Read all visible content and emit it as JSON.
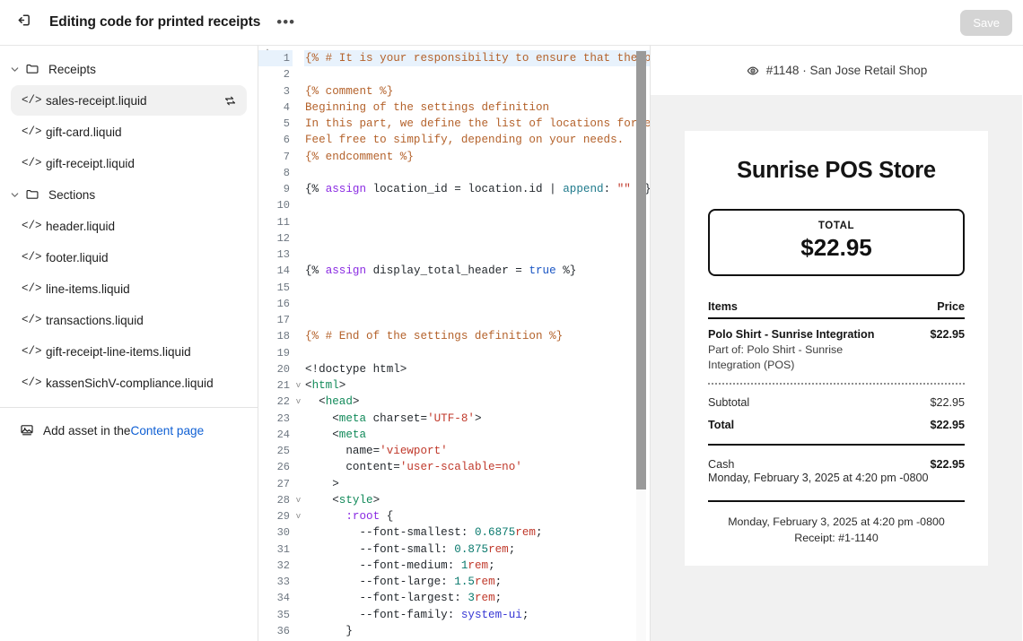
{
  "topbar": {
    "back_icon": "exit-arrow-icon",
    "title": "Editing code for printed receipts",
    "more_label": "•••",
    "save_label": "Save",
    "save_disabled": true,
    "save_bg": "#d4d4d4"
  },
  "sidebar": {
    "groups": [
      {
        "label": "Receipts",
        "icon": "folder-icon",
        "expanded": true,
        "files": [
          {
            "label": "sales-receipt.liquid",
            "selected": true,
            "trailing_icon": "sync-arrows-icon"
          },
          {
            "label": "gift-card.liquid",
            "selected": false,
            "trailing_icon": ""
          },
          {
            "label": "gift-receipt.liquid",
            "selected": false,
            "trailing_icon": ""
          }
        ]
      },
      {
        "label": "Sections",
        "icon": "folder-icon",
        "expanded": true,
        "files": [
          {
            "label": "header.liquid",
            "selected": false,
            "trailing_icon": ""
          },
          {
            "label": "footer.liquid",
            "selected": false,
            "trailing_icon": ""
          },
          {
            "label": "line-items.liquid",
            "selected": false,
            "trailing_icon": ""
          },
          {
            "label": "transactions.liquid",
            "selected": false,
            "trailing_icon": ""
          },
          {
            "label": "gift-receipt-line-items.liquid",
            "selected": false,
            "trailing_icon": ""
          },
          {
            "label": "kassenSichV-compliance.liquid",
            "selected": false,
            "trailing_icon": ""
          }
        ]
      }
    ],
    "add_asset": {
      "icon": "image-icon",
      "text_before": "Add asset in the ",
      "link_text": "Content page",
      "link_color": "#1060d4"
    }
  },
  "editor": {
    "active_line": 1,
    "first_line_number": 1,
    "last_line_number": 36,
    "lines": [
      {
        "n": 1,
        "fold": "",
        "tokens": [
          {
            "t": "{% # It is your responsibility to ensure that the prin",
            "c": "t-com"
          }
        ]
      },
      {
        "n": 2,
        "fold": "",
        "tokens": []
      },
      {
        "n": 3,
        "fold": "",
        "tokens": [
          {
            "t": "{% comment %}",
            "c": "t-com"
          }
        ]
      },
      {
        "n": 4,
        "fold": "",
        "tokens": [
          {
            "t": "Beginning of the settings definition",
            "c": "t-com"
          }
        ]
      },
      {
        "n": 5,
        "fold": "",
        "tokens": [
          {
            "t": "In this part, we define the list of locations for each",
            "c": "t-com"
          }
        ]
      },
      {
        "n": 6,
        "fold": "",
        "tokens": [
          {
            "t": "Feel free to simplify, depending on your needs.",
            "c": "t-com"
          }
        ]
      },
      {
        "n": 7,
        "fold": "",
        "tokens": [
          {
            "t": "{% endcomment %}",
            "c": "t-com"
          }
        ]
      },
      {
        "n": 8,
        "fold": "",
        "tokens": []
      },
      {
        "n": 9,
        "fold": "",
        "tokens": [
          {
            "t": "{% ",
            "c": "t-plain"
          },
          {
            "t": "assign",
            "c": "t-kw"
          },
          {
            "t": " location_id = location.id | ",
            "c": "t-plain"
          },
          {
            "t": "append",
            "c": "t-fn"
          },
          {
            "t": ": ",
            "c": "t-plain"
          },
          {
            "t": "\"\"",
            "c": "t-str"
          },
          {
            "t": " %}",
            "c": "t-plain"
          }
        ]
      },
      {
        "n": 10,
        "fold": "",
        "tokens": []
      },
      {
        "n": 11,
        "fold": "",
        "tokens": []
      },
      {
        "n": 12,
        "fold": "",
        "tokens": []
      },
      {
        "n": 13,
        "fold": "",
        "tokens": []
      },
      {
        "n": 14,
        "fold": "",
        "tokens": [
          {
            "t": "{% ",
            "c": "t-plain"
          },
          {
            "t": "assign",
            "c": "t-kw"
          },
          {
            "t": " display_total_header = ",
            "c": "t-plain"
          },
          {
            "t": "true",
            "c": "t-bool"
          },
          {
            "t": " %}",
            "c": "t-plain"
          }
        ]
      },
      {
        "n": 15,
        "fold": "",
        "tokens": []
      },
      {
        "n": 16,
        "fold": "",
        "tokens": []
      },
      {
        "n": 17,
        "fold": "",
        "tokens": []
      },
      {
        "n": 18,
        "fold": "",
        "tokens": [
          {
            "t": "{% # End of the settings definition %}",
            "c": "t-com"
          }
        ]
      },
      {
        "n": 19,
        "fold": "",
        "tokens": []
      },
      {
        "n": 20,
        "fold": "",
        "tokens": [
          {
            "t": "<!doctype html>",
            "c": "t-plain"
          }
        ]
      },
      {
        "n": 21,
        "fold": "v",
        "tokens": [
          {
            "t": "<",
            "c": "t-plain"
          },
          {
            "t": "html",
            "c": "t-tag"
          },
          {
            "t": ">",
            "c": "t-plain"
          }
        ]
      },
      {
        "n": 22,
        "fold": "v",
        "tokens": [
          {
            "t": "  <",
            "c": "t-plain"
          },
          {
            "t": "head",
            "c": "t-tag"
          },
          {
            "t": ">",
            "c": "t-plain"
          }
        ]
      },
      {
        "n": 23,
        "fold": "",
        "tokens": [
          {
            "t": "    <",
            "c": "t-plain"
          },
          {
            "t": "meta",
            "c": "t-tag"
          },
          {
            "t": " charset=",
            "c": "t-plain"
          },
          {
            "t": "'UTF-8'",
            "c": "t-str"
          },
          {
            "t": ">",
            "c": "t-plain"
          }
        ]
      },
      {
        "n": 24,
        "fold": "",
        "tokens": [
          {
            "t": "    <",
            "c": "t-plain"
          },
          {
            "t": "meta",
            "c": "t-tag"
          }
        ]
      },
      {
        "n": 25,
        "fold": "",
        "tokens": [
          {
            "t": "      name=",
            "c": "t-plain"
          },
          {
            "t": "'viewport'",
            "c": "t-str"
          }
        ]
      },
      {
        "n": 26,
        "fold": "",
        "tokens": [
          {
            "t": "      content=",
            "c": "t-plain"
          },
          {
            "t": "'user-scalable=no'",
            "c": "t-str"
          }
        ]
      },
      {
        "n": 27,
        "fold": "",
        "tokens": [
          {
            "t": "    >",
            "c": "t-plain"
          }
        ]
      },
      {
        "n": 28,
        "fold": "v",
        "tokens": [
          {
            "t": "    <",
            "c": "t-plain"
          },
          {
            "t": "style",
            "c": "t-tag"
          },
          {
            "t": ">",
            "c": "t-plain"
          }
        ]
      },
      {
        "n": 29,
        "fold": "v",
        "tokens": [
          {
            "t": "      ",
            "c": "t-plain"
          },
          {
            "t": ":root",
            "c": "t-sel"
          },
          {
            "t": " {",
            "c": "t-plain"
          }
        ]
      },
      {
        "n": 30,
        "fold": "",
        "tokens": [
          {
            "t": "        --font-smallest: ",
            "c": "t-plain"
          },
          {
            "t": "0.6875",
            "c": "t-num"
          },
          {
            "t": "rem",
            "c": "t-unit"
          },
          {
            "t": ";",
            "c": "t-plain"
          }
        ]
      },
      {
        "n": 31,
        "fold": "",
        "tokens": [
          {
            "t": "        --font-small: ",
            "c": "t-plain"
          },
          {
            "t": "0.875",
            "c": "t-num"
          },
          {
            "t": "rem",
            "c": "t-unit"
          },
          {
            "t": ";",
            "c": "t-plain"
          }
        ]
      },
      {
        "n": 32,
        "fold": "",
        "tokens": [
          {
            "t": "        --font-medium: ",
            "c": "t-plain"
          },
          {
            "t": "1",
            "c": "t-num"
          },
          {
            "t": "rem",
            "c": "t-unit"
          },
          {
            "t": ";",
            "c": "t-plain"
          }
        ]
      },
      {
        "n": 33,
        "fold": "",
        "tokens": [
          {
            "t": "        --font-large: ",
            "c": "t-plain"
          },
          {
            "t": "1.5",
            "c": "t-num"
          },
          {
            "t": "rem",
            "c": "t-unit"
          },
          {
            "t": ";",
            "c": "t-plain"
          }
        ]
      },
      {
        "n": 34,
        "fold": "",
        "tokens": [
          {
            "t": "        --font-largest: ",
            "c": "t-plain"
          },
          {
            "t": "3",
            "c": "t-num"
          },
          {
            "t": "rem",
            "c": "t-unit"
          },
          {
            "t": ";",
            "c": "t-plain"
          }
        ]
      },
      {
        "n": 35,
        "fold": "",
        "tokens": [
          {
            "t": "        --font-family: ",
            "c": "t-plain"
          },
          {
            "t": "system-ui",
            "c": "t-val"
          },
          {
            "t": ";",
            "c": "t-plain"
          }
        ]
      },
      {
        "n": 36,
        "fold": "",
        "tokens": [
          {
            "t": "      }",
            "c": "t-plain"
          }
        ]
      }
    ]
  },
  "preview": {
    "header": {
      "icon": "eye-icon",
      "text": "#1148 · San Jose Retail Shop"
    },
    "receipt": {
      "store_name": "Sunrise POS Store",
      "total_box": {
        "label": "TOTAL",
        "amount": "$22.95"
      },
      "table_header": {
        "items": "Items",
        "price": "Price"
      },
      "line_items": [
        {
          "name": "Polo Shirt - Sunrise Integration",
          "price": "$22.95",
          "sub": "Part of: Polo Shirt - Sunrise Integration (POS)"
        }
      ],
      "totals": [
        {
          "label": "Subtotal",
          "value": "$22.95",
          "bold": false
        },
        {
          "label": "Total",
          "value": "$22.95",
          "bold": true
        }
      ],
      "payment": {
        "method": "Cash",
        "amount": "$22.95",
        "date": "Monday, February 3, 2025 at 4:20 pm -0800"
      },
      "footer": {
        "date": "Monday, February 3, 2025 at 4:20 pm -0800",
        "receipt_number": "Receipt: #1-1140"
      }
    }
  }
}
